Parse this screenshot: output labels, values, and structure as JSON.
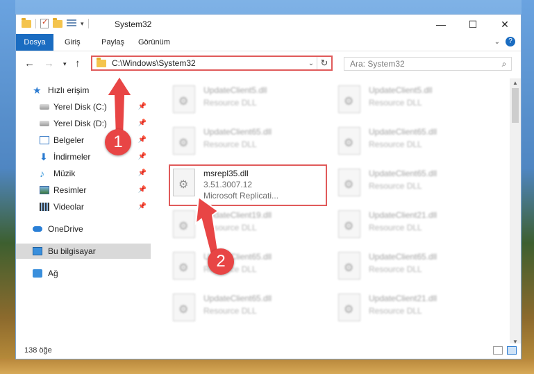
{
  "window": {
    "title": "System32",
    "controls": {
      "minimize": "—",
      "maximize": "☐",
      "close": "✕"
    }
  },
  "ribbon": {
    "tabs": [
      "Dosya",
      "Giriş",
      "Paylaş",
      "Görünüm"
    ],
    "expand_icon": "chevron-down-icon",
    "help_label": "?"
  },
  "address": {
    "path": "C:\\Windows\\System32",
    "search_placeholder": "Ara: System32"
  },
  "sidebar": {
    "items": [
      {
        "label": "Hızlı erişim",
        "icon": "star-icon",
        "pinned": false
      },
      {
        "label": "Yerel Disk (C:)",
        "icon": "disk-icon",
        "pinned": true
      },
      {
        "label": "Yerel Disk (D:)",
        "icon": "disk-icon",
        "pinned": true
      },
      {
        "label": "Belgeler",
        "icon": "documents-icon",
        "pinned": true
      },
      {
        "label": "İndirmeler",
        "icon": "download-icon",
        "pinned": true
      },
      {
        "label": "Müzik",
        "icon": "music-icon",
        "pinned": true
      },
      {
        "label": "Resimler",
        "icon": "pictures-icon",
        "pinned": true
      },
      {
        "label": "Videolar",
        "icon": "videos-icon",
        "pinned": true
      },
      {
        "label": "OneDrive",
        "icon": "cloud-icon",
        "pinned": false
      },
      {
        "label": "Bu bilgisayar",
        "icon": "computer-icon",
        "pinned": false,
        "selected": true
      },
      {
        "label": "Ağ",
        "icon": "network-icon",
        "pinned": false
      }
    ]
  },
  "files": {
    "left": [
      {
        "name": "UpdateClient5.dll",
        "desc": "Resource DLL"
      },
      {
        "name": "UpdateClient65.dll",
        "desc": "Resource DLL"
      },
      {
        "name": "msrepl35.dll",
        "desc": "3.51.3007.12",
        "desc2": "Microsoft Replicati...",
        "highlighted": true
      },
      {
        "name": "UpdateClient19.dll",
        "desc": "Resource DLL"
      },
      {
        "name": "UpdateClient65.dll",
        "desc": "Resource DLL"
      },
      {
        "name": "UpdateClient65.dll",
        "desc": "Resource DLL"
      }
    ],
    "right": [
      {
        "name": "UpdateClient5.dll",
        "desc": "Resource DLL"
      },
      {
        "name": "UpdateClient65.dll",
        "desc": "Resource DLL"
      },
      {
        "name": "UpdateClient65.dll",
        "desc": "Resource DLL"
      },
      {
        "name": "UpdateClient21.dll",
        "desc": "Resource DLL"
      },
      {
        "name": "UpdateClient65.dll",
        "desc": "Resource DLL"
      },
      {
        "name": "UpdateClient21.dll",
        "desc": "Resource DLL"
      }
    ]
  },
  "status": {
    "count_text": "138 öğe"
  },
  "callouts": {
    "one": "1",
    "two": "2"
  },
  "colors": {
    "accent": "#1a6cc1",
    "highlight": "#e05a5a",
    "callout": "#e84545"
  }
}
